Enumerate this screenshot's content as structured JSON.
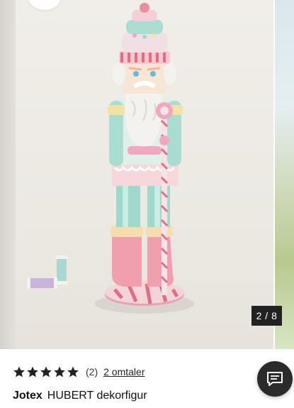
{
  "gallery": {
    "image_alt": "HUBERT dekorfigur",
    "counter": "2 / 8"
  },
  "rating": {
    "stars": 5,
    "count": "(2)",
    "reviews_link": "2 omtaler"
  },
  "product": {
    "brand": "Jotex",
    "name": "HUBERT dekorfigur"
  },
  "chat": {
    "icon": "chat-bubble-icon"
  },
  "colors": {
    "counter_bg": "#222222",
    "chat_bg": "#2b2b2b",
    "star": "#222222"
  }
}
